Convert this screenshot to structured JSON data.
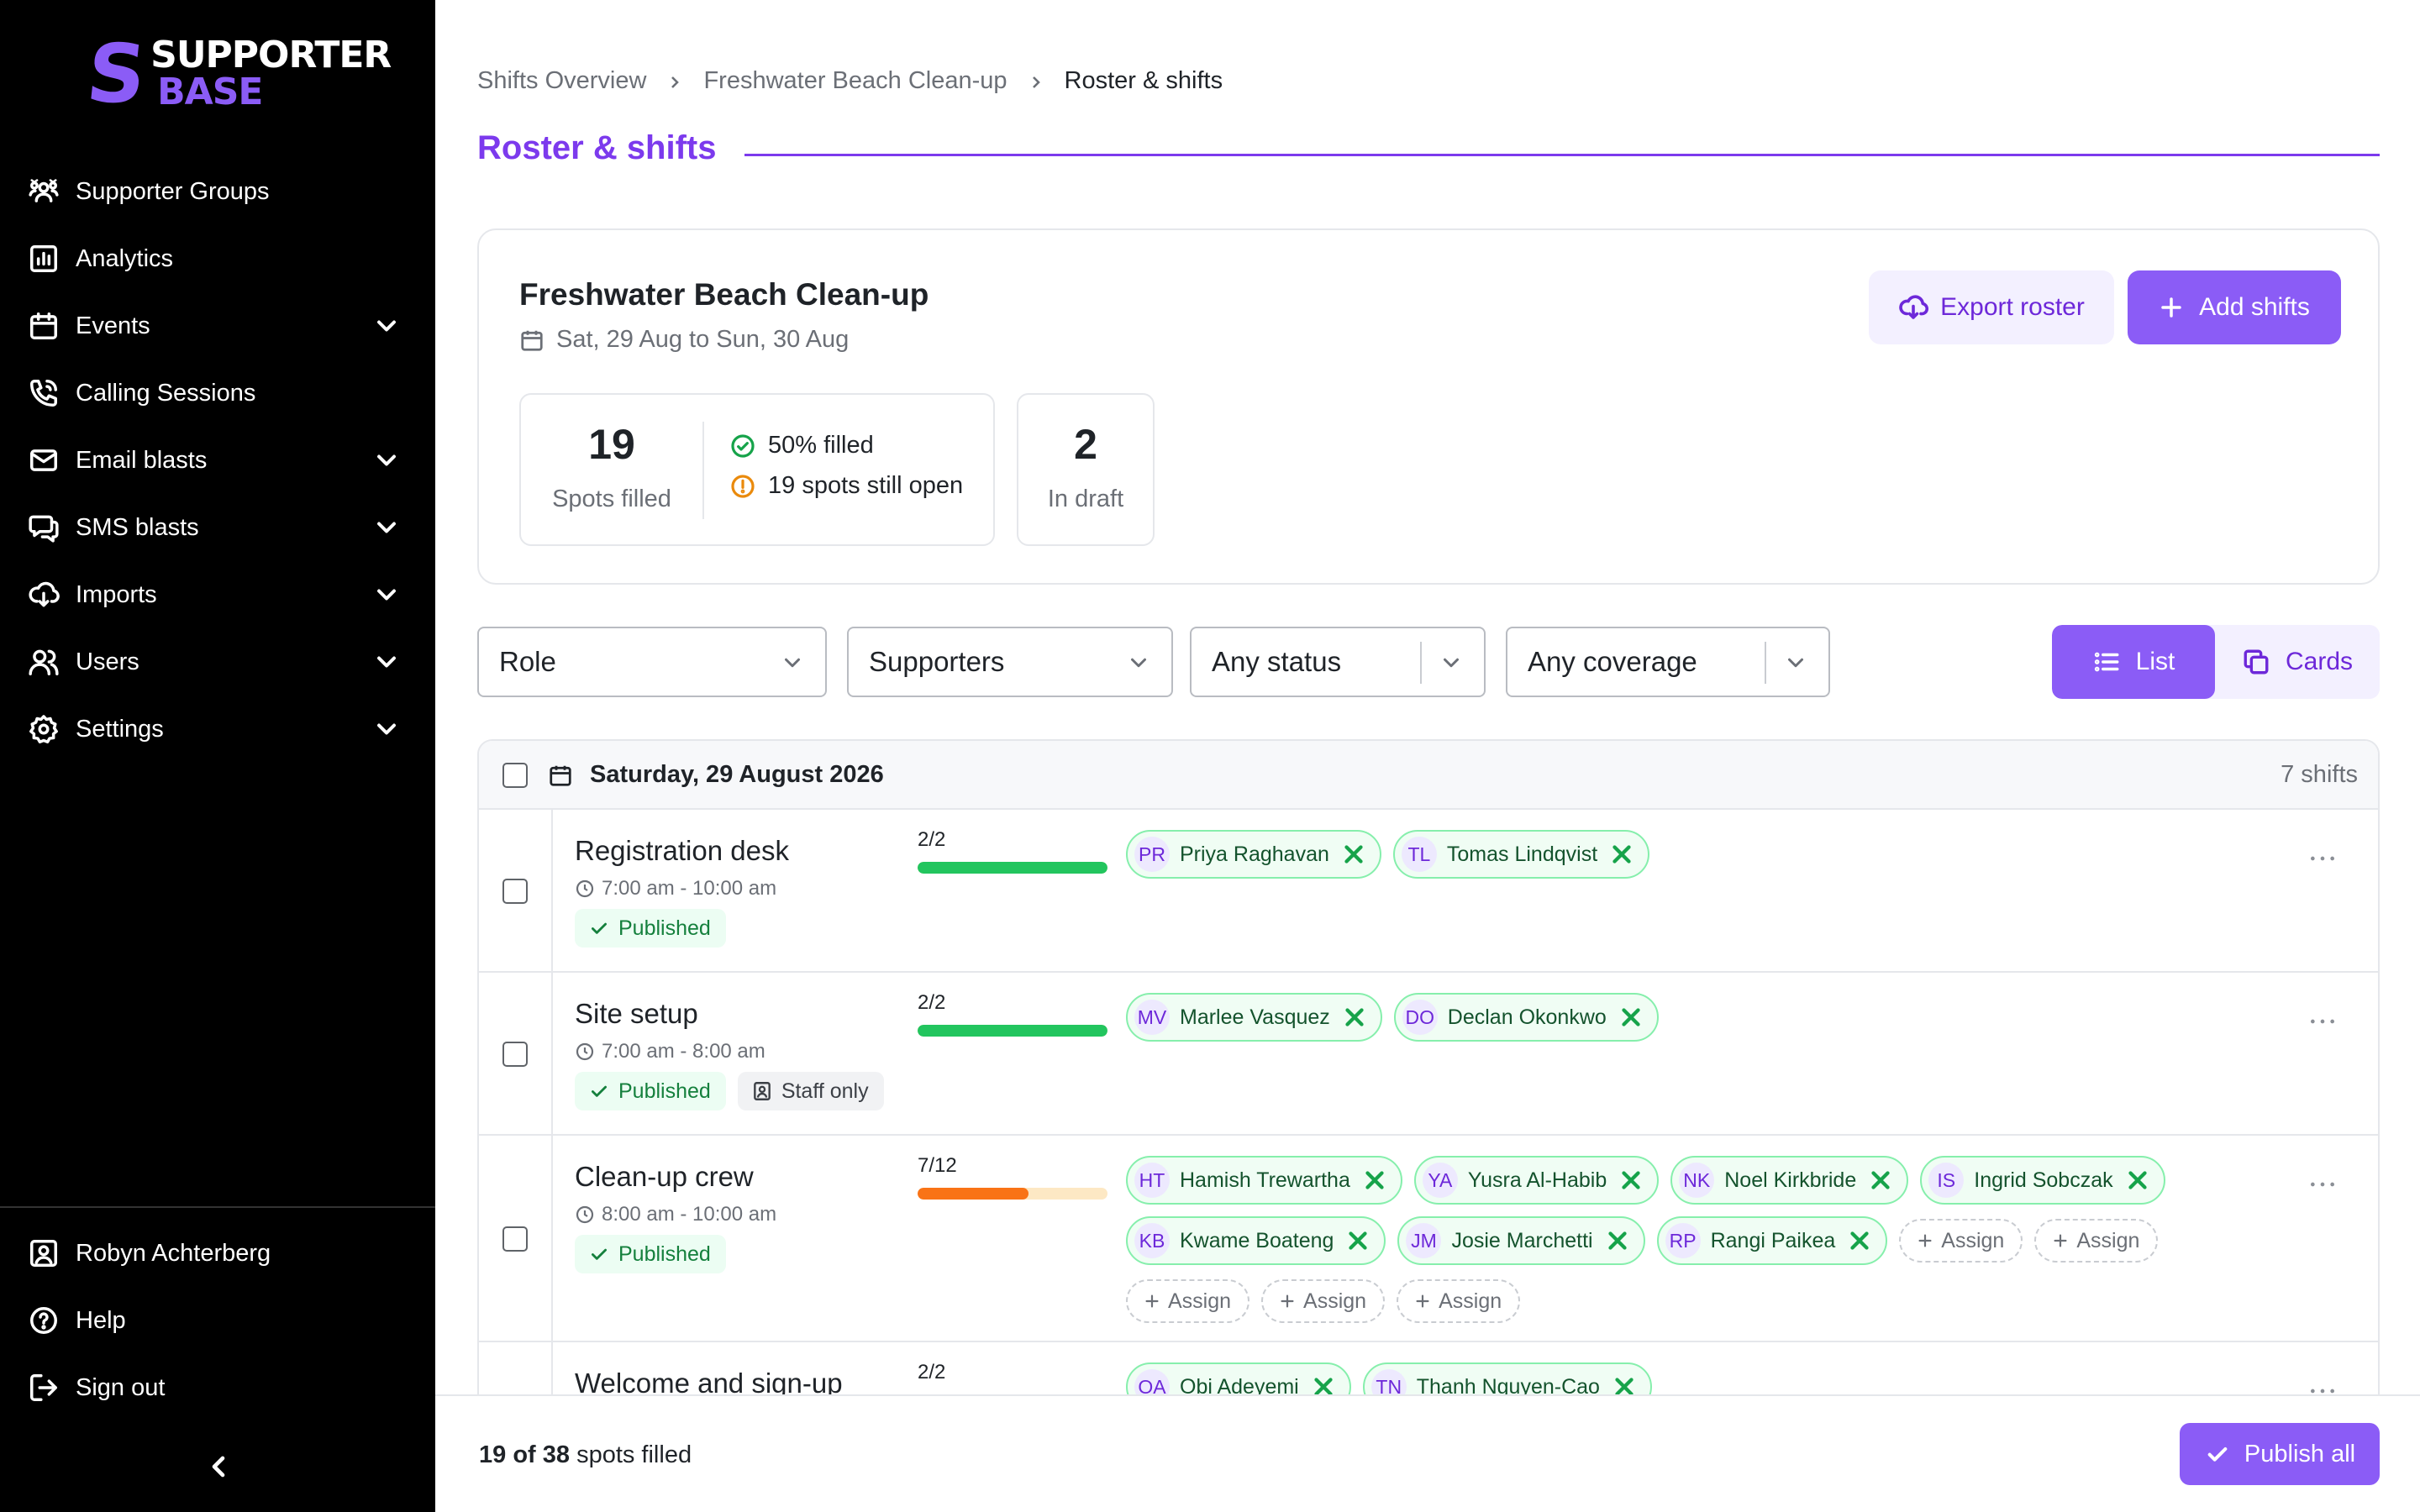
{
  "brand": {
    "line1": "SUPPORTER",
    "line2": "BASE",
    "mark": "S",
    "accent": "#8b5cf6"
  },
  "sidebar": {
    "items": [
      {
        "label": "Supporter Groups",
        "icon": "people-icon",
        "expandable": false
      },
      {
        "label": "Analytics",
        "icon": "bar-chart-icon",
        "expandable": false
      },
      {
        "label": "Events",
        "icon": "calendar-icon",
        "expandable": true
      },
      {
        "label": "Calling Sessions",
        "icon": "phone-icon",
        "expandable": false
      },
      {
        "label": "Email blasts",
        "icon": "mail-icon",
        "expandable": true
      },
      {
        "label": "SMS blasts",
        "icon": "chat-icon",
        "expandable": true
      },
      {
        "label": "Imports",
        "icon": "import-icon",
        "expandable": true
      },
      {
        "label": "Users",
        "icon": "users-icon",
        "expandable": true
      },
      {
        "label": "Settings",
        "icon": "gear-icon",
        "expandable": true
      }
    ],
    "bottom": [
      {
        "label": "Robyn Achterberg",
        "icon": "user-badge-icon"
      },
      {
        "label": "Help",
        "icon": "help-icon"
      },
      {
        "label": "Sign out",
        "icon": "sign-out-icon"
      }
    ]
  },
  "breadcrumb": [
    "Shifts Overview",
    "Freshwater Beach Clean-up",
    "Roster & shifts"
  ],
  "page_title": "Roster & shifts",
  "event": {
    "name": "Freshwater Beach Clean-up",
    "dates": "Sat, 29 Aug to Sun, 30 Aug",
    "export_label": "Export roster",
    "add_label": "Add shifts",
    "spots_filled": "19",
    "spots_filled_label": "Spots filled",
    "filled_pct_text": "50% filled",
    "open_text": "19 spots still open",
    "draft_count": "2",
    "draft_label": "In draft"
  },
  "filters": {
    "role": "Role",
    "supporters": "Supporters",
    "status": "Any status",
    "coverage": "Any coverage"
  },
  "view": {
    "list": "List",
    "cards": "Cards",
    "selected": "List"
  },
  "day": {
    "title": "Saturday, 29 August 2026",
    "count": "7 shifts",
    "shifts": [
      {
        "name": "Registration desk",
        "time": "7:00 am - 10:00 am",
        "badges": [
          "Published"
        ],
        "ratio": "2/2",
        "fill": 1.0,
        "fill_color": "#22c55e",
        "assigned": [
          {
            "initials": "PR",
            "name": "Priya Raghavan"
          },
          {
            "initials": "TL",
            "name": "Tomas Lindqvist"
          }
        ],
        "open_slots": 0
      },
      {
        "name": "Site setup",
        "time": "7:00 am - 8:00 am",
        "badges": [
          "Published",
          "Staff only"
        ],
        "ratio": "2/2",
        "fill": 1.0,
        "fill_color": "#22c55e",
        "assigned": [
          {
            "initials": "MV",
            "name": "Marlee Vasquez"
          },
          {
            "initials": "DO",
            "name": "Declan Okonkwo"
          }
        ],
        "open_slots": 0
      },
      {
        "name": "Clean-up crew",
        "time": "8:00 am - 10:00 am",
        "badges": [
          "Published"
        ],
        "ratio": "7/12",
        "fill": 0.583,
        "fill_color": "#f97316",
        "assigned": [
          {
            "initials": "HT",
            "name": "Hamish Trewartha"
          },
          {
            "initials": "YA",
            "name": "Yusra Al-Habib"
          },
          {
            "initials": "NK",
            "name": "Noel Kirkbride"
          },
          {
            "initials": "IS",
            "name": "Ingrid Sobczak"
          },
          {
            "initials": "KB",
            "name": "Kwame Boateng"
          },
          {
            "initials": "JM",
            "name": "Josie Marchetti"
          },
          {
            "initials": "RP",
            "name": "Rangi Paikea"
          }
        ],
        "open_slots": 5,
        "assign_label": "Assign"
      },
      {
        "name": "Welcome and sign-up",
        "time": "",
        "badges": [],
        "ratio": "2/2",
        "fill": 1.0,
        "fill_color": "#22c55e",
        "assigned": [
          {
            "initials": "OA",
            "name": "Obi Adeyemi"
          },
          {
            "initials": "TN",
            "name": "Thanh Nguyen-Cao"
          }
        ],
        "open_slots": 0
      }
    ]
  },
  "footer": {
    "filled": "19 of 38",
    "suffix": "spots filled",
    "publish_label": "Publish all"
  }
}
